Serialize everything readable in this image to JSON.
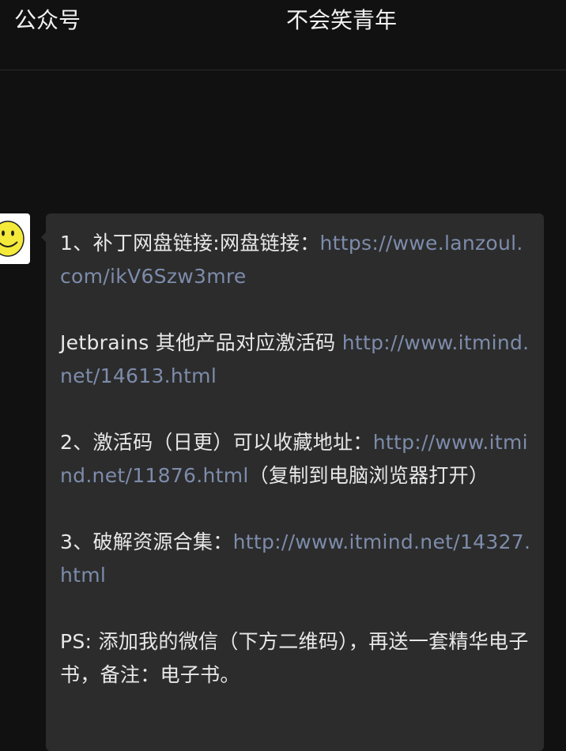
{
  "topbar": {
    "left_label": "公众号",
    "title": "不会笑青年"
  },
  "message": {
    "p1_text": "1、补丁网盘链接:网盘链接：",
    "p1_link": "https://wwe.lanzoul.com/ikV6Szw3mre",
    "p2_text": "Jetbrains 其他产品对应激活码 ",
    "p2_link": "http://www.itmind.net/14613.html",
    "p3_text": " 2、激活码（日更）可以收藏地址：",
    "p3_link": "http://www.itmind.net/11876.html",
    "p3_tail": "（复制到电脑浏览器打开）",
    "p4_text": "3、破解资源合集：",
    "p4_link": "http://www.itmind.net/14327.html",
    "p5_text": "PS: 添加我的微信（下方二维码），再送一套精华电子书，备注：电子书。"
  },
  "avatar": {
    "icon": "smiley-face-icon"
  },
  "colors": {
    "background": "#111111",
    "bubble": "#2c2c2c",
    "text": "#e8e8e8",
    "link": "#7d8cab"
  }
}
